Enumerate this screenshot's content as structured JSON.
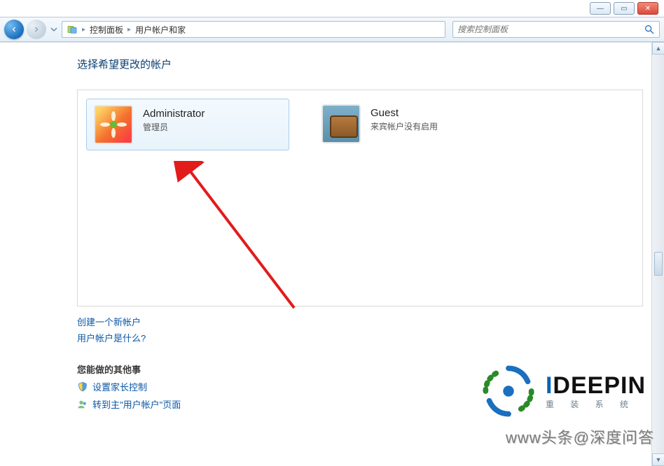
{
  "window_controls": {
    "minimize": "—",
    "maximize": "▭",
    "close": "✕"
  },
  "breadcrumb": {
    "root_icon": "control-panel-icon",
    "items": [
      "控制面板",
      "用户帐户和家"
    ],
    "more": ""
  },
  "search": {
    "placeholder": "搜索控制面板"
  },
  "page": {
    "title": "选择希望更改的帐户"
  },
  "accounts": [
    {
      "name": "Administrator",
      "desc": "管理员",
      "selected": true,
      "avatar": "flower"
    },
    {
      "name": "Guest",
      "desc": "来宾帐户没有启用",
      "selected": false,
      "avatar": "suitcase"
    }
  ],
  "links": {
    "create_new": "创建一个新帐户",
    "what_is": "用户帐户是什么?"
  },
  "section": {
    "heading": "您能做的其他事",
    "parental": "设置家长控制",
    "goto_main": "转到主\"用户帐户\"页面"
  },
  "watermark": {
    "brand_prefix": "I",
    "brand_rest": "DEEPIN",
    "sub": "重   装   系   统",
    "byline": "www头条@深度问答"
  }
}
